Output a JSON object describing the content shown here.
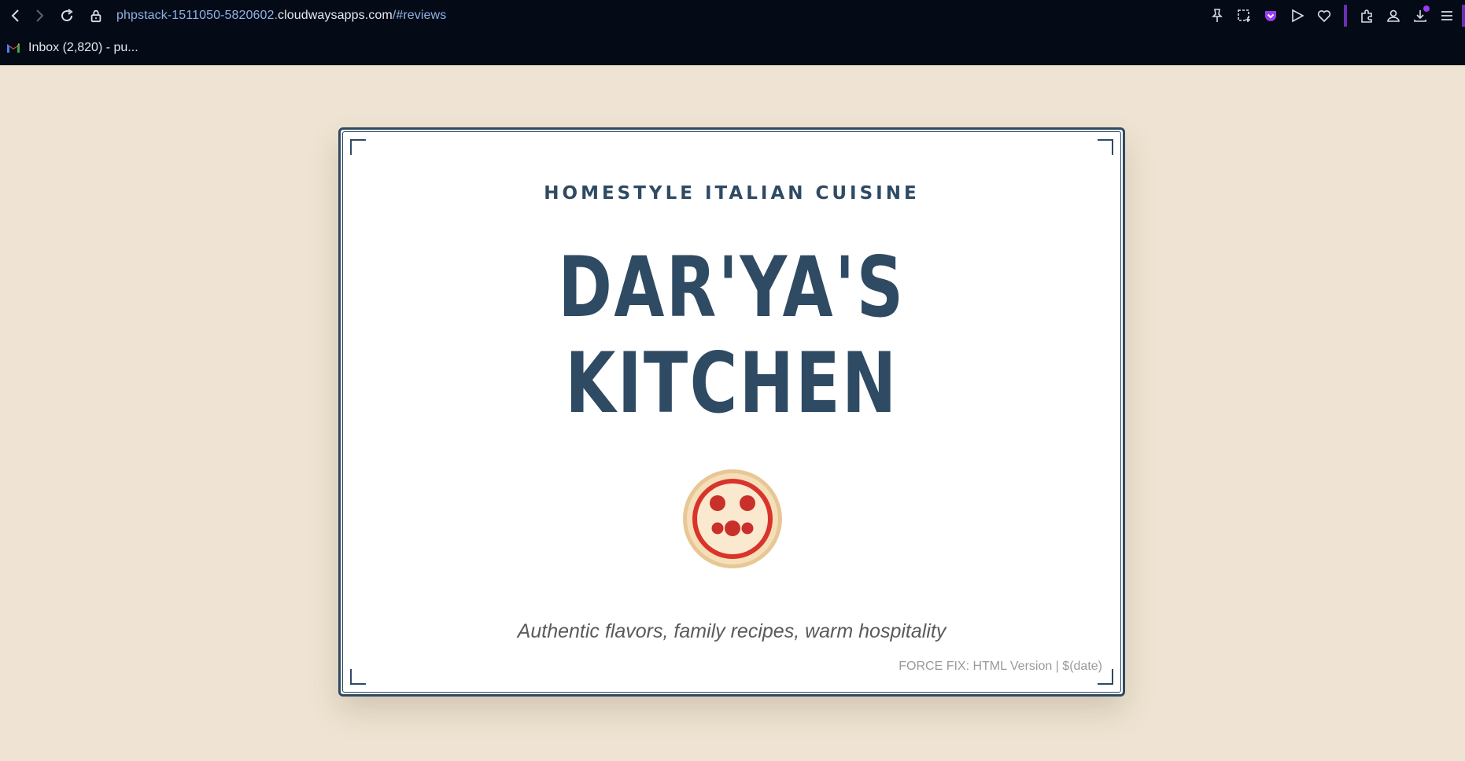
{
  "browser": {
    "url_prefix": "phpstack-1511050-5820602.",
    "url_domain": "cloudwaysapps.com",
    "url_path": "/#reviews",
    "bookmark_label": "Inbox (2,820) - pu..."
  },
  "card": {
    "tagline": "HOMESTYLE ITALIAN CUISINE",
    "title_line1": "DAR'YA'S",
    "title_line2": "KITCHEN",
    "subtitle": "Authentic flavors, family recipes, warm hospitality",
    "footer_note": "FORCE FIX: HTML Version | $(date)"
  },
  "icons": {
    "logo": "pizza-icon"
  },
  "colors": {
    "page_background": "#efe4d3",
    "brand_navy": "#2f4a63",
    "pizza_crust": "#e8c796",
    "pizza_sauce": "#d9342b",
    "pizza_cheese": "#fbe9cf",
    "chrome_background": "#050b16"
  }
}
